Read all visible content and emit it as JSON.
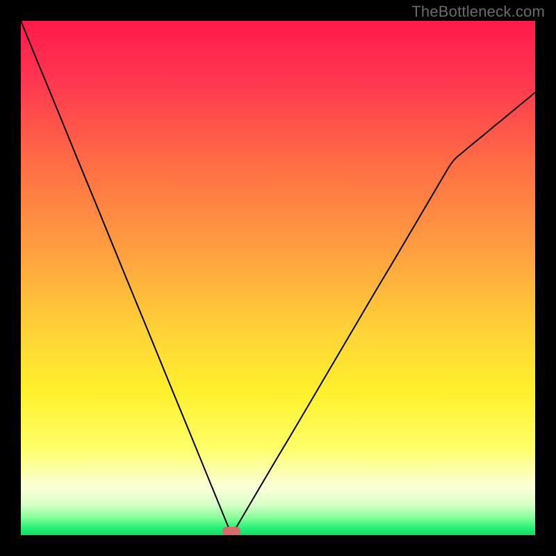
{
  "watermark": "TheBottleneck.com",
  "marker": {
    "color": "#d96b6b"
  },
  "gradient_stops": [
    {
      "pos": 0.0,
      "color": "#ff1a4c"
    },
    {
      "pos": 0.12,
      "color": "#ff3850"
    },
    {
      "pos": 0.28,
      "color": "#ff6e45"
    },
    {
      "pos": 0.45,
      "color": "#ffa040"
    },
    {
      "pos": 0.6,
      "color": "#ffd238"
    },
    {
      "pos": 0.72,
      "color": "#fff02c"
    },
    {
      "pos": 0.83,
      "color": "#fdff68"
    },
    {
      "pos": 0.905,
      "color": "#fcffd8"
    },
    {
      "pos": 0.94,
      "color": "#d8ffc8"
    },
    {
      "pos": 0.965,
      "color": "#88ff9a"
    },
    {
      "pos": 0.985,
      "color": "#2af27a"
    },
    {
      "pos": 1.0,
      "color": "#0fd964"
    }
  ],
  "chart_data": {
    "type": "line",
    "title": "",
    "xlabel": "",
    "ylabel": "",
    "xlim": [
      0,
      100
    ],
    "ylim": [
      0,
      100
    ],
    "optimum_x": 41,
    "x": [
      0,
      2,
      4,
      6,
      8,
      10,
      12,
      14,
      16,
      18,
      20,
      22,
      24,
      26,
      28,
      30,
      32,
      34,
      36,
      38,
      39,
      40,
      41,
      42,
      43,
      44,
      46,
      48,
      50,
      52,
      54,
      56,
      58,
      60,
      62,
      64,
      66,
      68,
      70,
      72,
      74,
      76,
      78,
      80,
      82,
      84,
      86,
      88,
      90,
      92,
      94,
      96,
      98,
      100
    ],
    "values": [
      100,
      95.1,
      90.2,
      85.4,
      80.5,
      75.6,
      70.7,
      65.9,
      61.0,
      56.1,
      51.2,
      46.3,
      41.5,
      36.6,
      31.7,
      26.8,
      22.0,
      17.1,
      12.2,
      7.3,
      4.9,
      2.4,
      0.0,
      1.7,
      3.4,
      5.1,
      8.5,
      11.9,
      15.3,
      18.6,
      22.0,
      25.4,
      28.8,
      32.2,
      35.6,
      39.0,
      42.4,
      45.8,
      49.2,
      52.5,
      55.9,
      59.3,
      62.7,
      66.1,
      69.5,
      72.9,
      74.5,
      76.2,
      77.8,
      79.5,
      81.1,
      82.8,
      84.4,
      86.1
    ]
  }
}
